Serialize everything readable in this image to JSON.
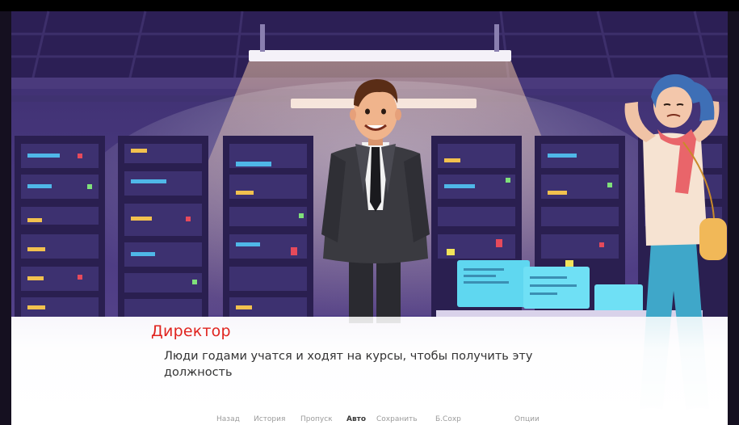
{
  "dialogue": {
    "speaker": "Директор",
    "text": "Люди годами учатся и ходят на курсы, чтобы получить эту должность"
  },
  "quick_menu": {
    "back": "Назад",
    "history": "История",
    "skip": "Пропуск",
    "auto": "Авто",
    "save": "Сохранить",
    "quick_save": "Б.Сохр",
    "options": "Опции",
    "active": "auto"
  },
  "colors": {
    "speaker": "#e0241f",
    "background_wall": "#3a2a6e",
    "suit": "#2e2e33",
    "scarf": "#e9656a",
    "jeans": "#3fa7c9"
  },
  "icons": [
    "server-rack-icon",
    "monitor-icon"
  ]
}
